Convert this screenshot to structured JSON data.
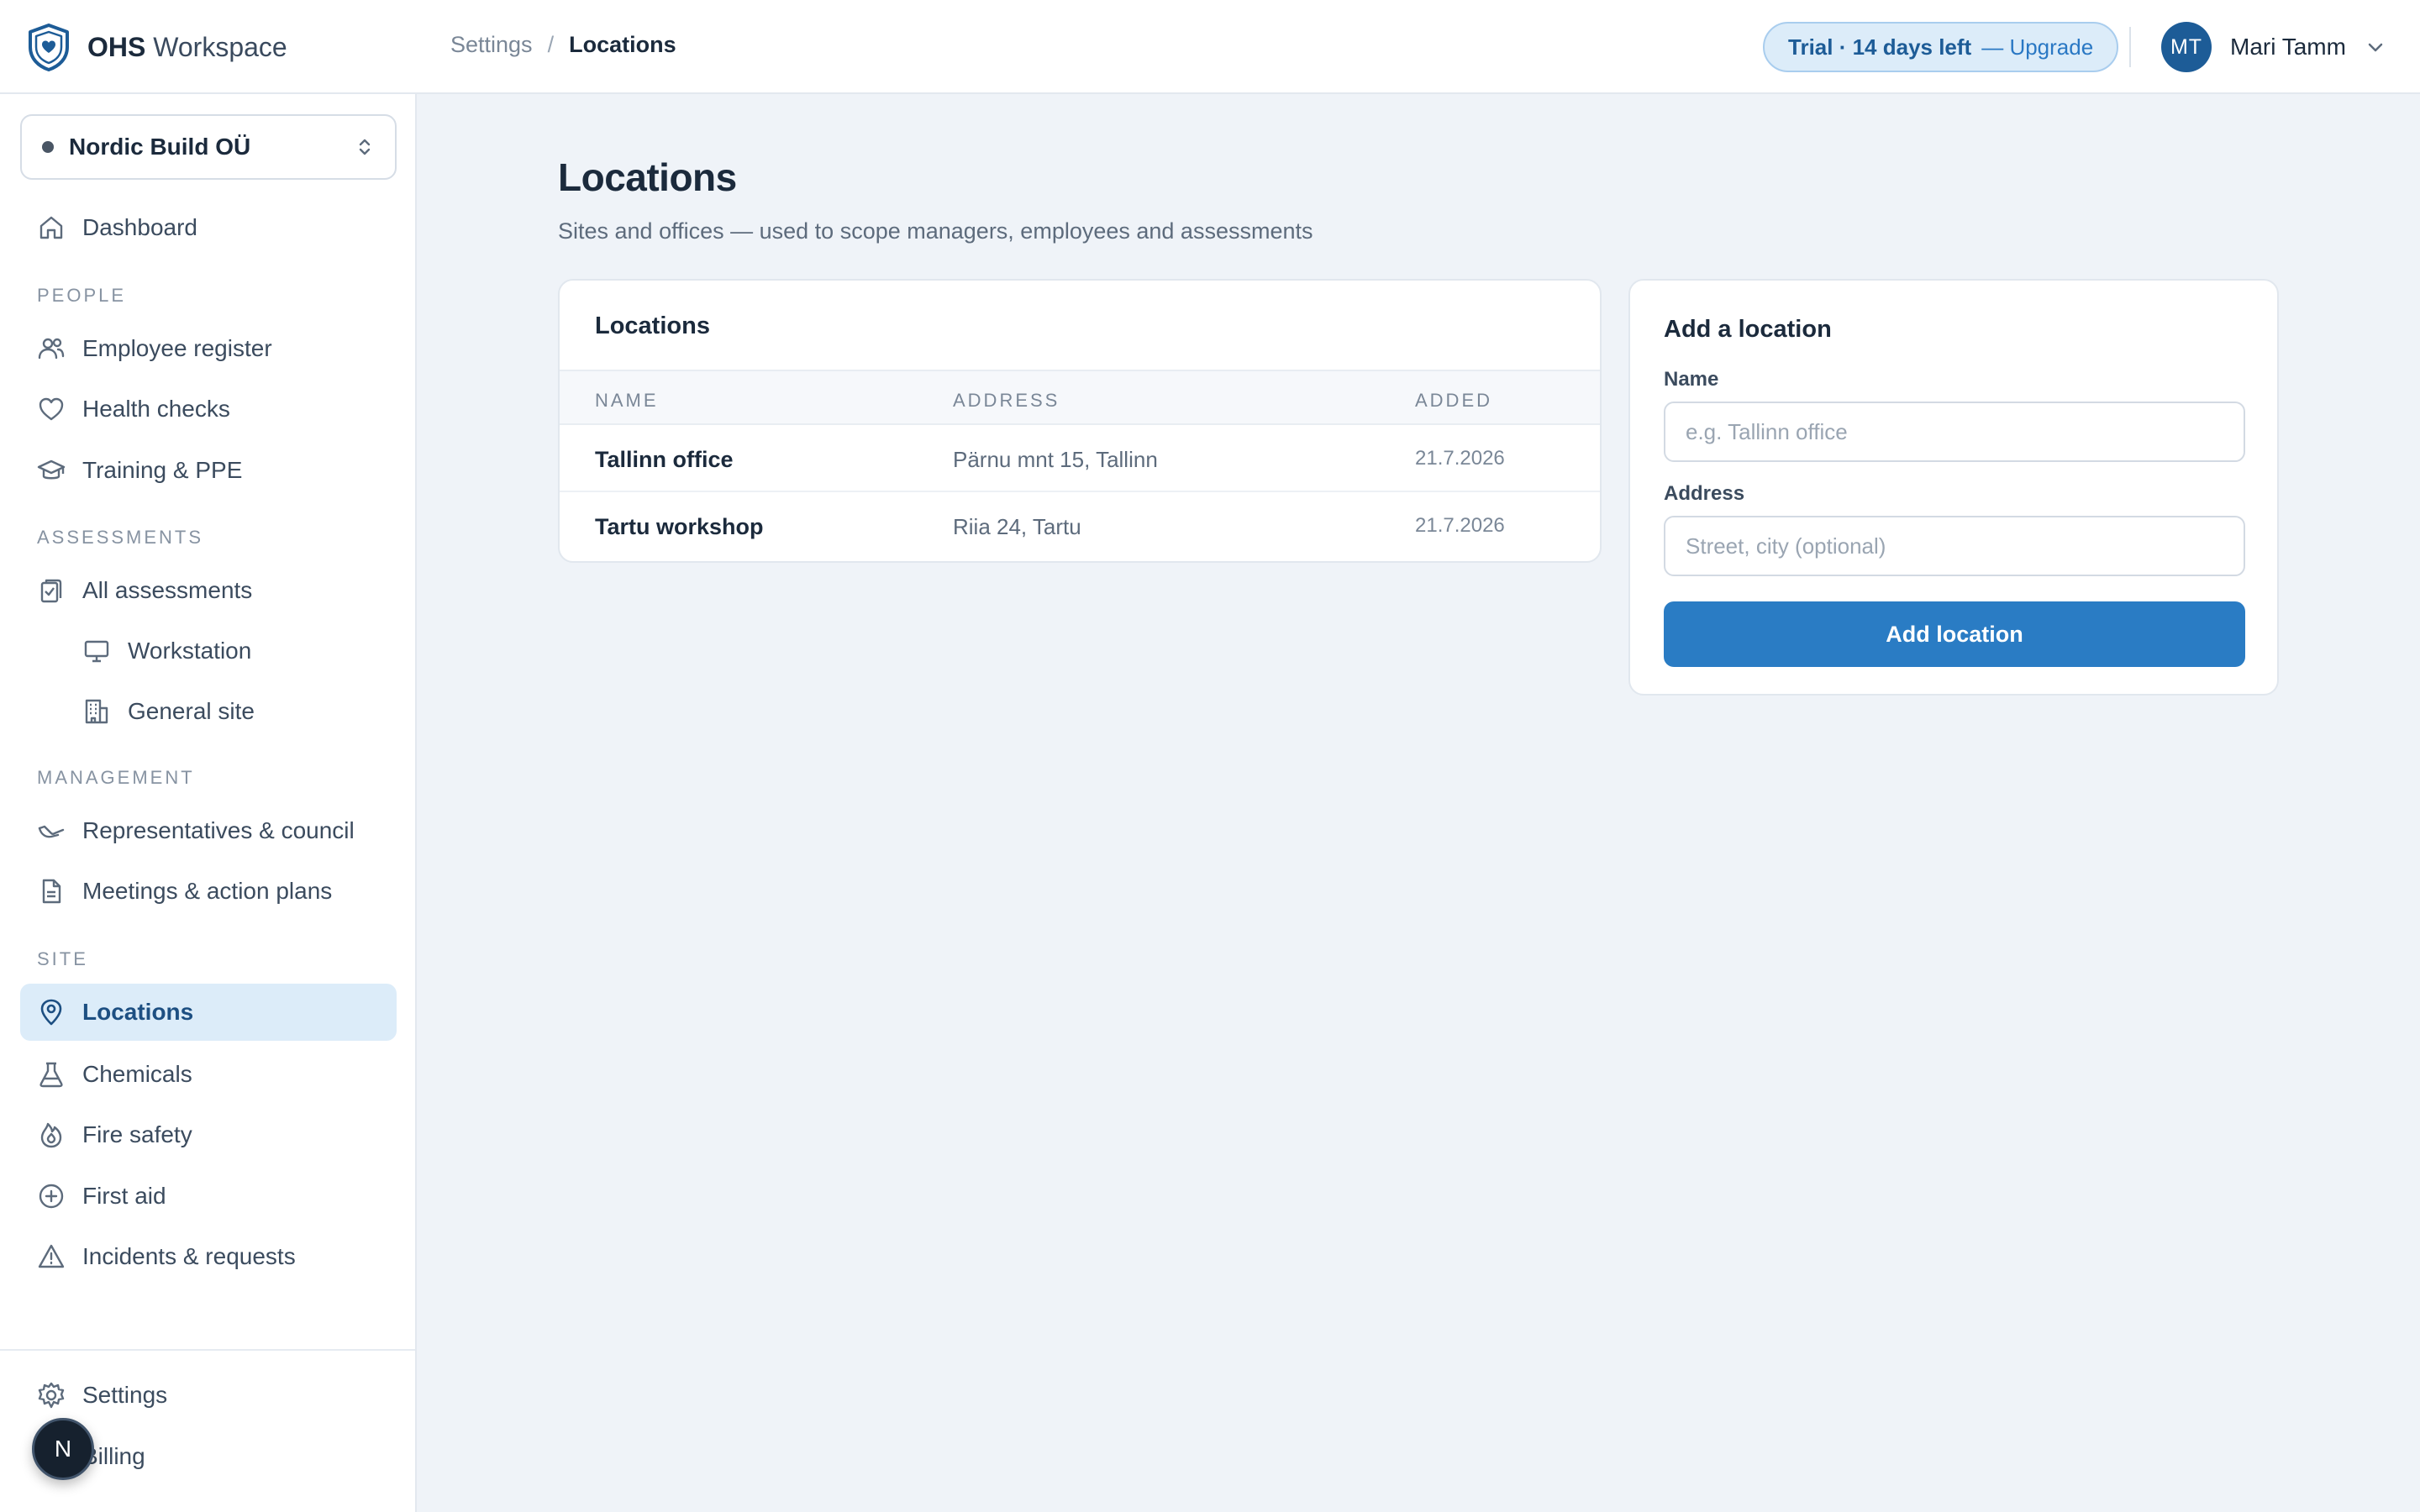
{
  "app": {
    "name_bold": "OHS",
    "name_rest": "Workspace"
  },
  "breadcrumb": {
    "parent": "Settings",
    "separator": "/",
    "current": "Locations"
  },
  "trial": {
    "status": "Trial · 14 days left",
    "action": "— Upgrade"
  },
  "user": {
    "initials": "MT",
    "name": "Mari Tamm"
  },
  "org": {
    "name": "Nordic Build OÜ"
  },
  "sidebar": {
    "dashboard": "Dashboard",
    "sections": {
      "people": "PEOPLE",
      "assessments": "ASSESSMENTS",
      "management": "MANAGEMENT",
      "site": "SITE"
    },
    "items": {
      "employee_register": "Employee register",
      "health_checks": "Health checks",
      "training_ppe": "Training & PPE",
      "all_assessments": "All assessments",
      "workstation": "Workstation",
      "general_site": "General site",
      "representatives": "Representatives & council",
      "meetings": "Meetings & action plans",
      "locations": "Locations",
      "chemicals": "Chemicals",
      "fire_safety": "Fire safety",
      "first_aid": "First aid",
      "incidents": "Incidents & requests",
      "settings": "Settings",
      "billing": "Billing"
    },
    "active": "Locations"
  },
  "fab": {
    "label": "N"
  },
  "page": {
    "title": "Locations",
    "subtitle": "Sites and offices — used to scope managers, employees and assessments"
  },
  "table": {
    "title": "Locations",
    "columns": [
      "NAME",
      "ADDRESS",
      "ADDED"
    ],
    "rows": [
      {
        "name": "Tallinn office",
        "address": "Pärnu mnt 15, Tallinn",
        "added": "21.7.2026"
      },
      {
        "name": "Tartu workshop",
        "address": "Riia 24, Tartu",
        "added": "21.7.2026"
      }
    ]
  },
  "form": {
    "title": "Add a location",
    "name_label": "Name",
    "name_placeholder": "e.g. Tallinn office",
    "name_value": "",
    "address_label": "Address",
    "address_placeholder": "Street, city (optional)",
    "address_value": "",
    "submit": "Add location"
  },
  "colors": {
    "primary": "#2a7cc4",
    "primary_dark": "#1d5c97",
    "active_bg": "#dcecf9",
    "background": "#eff3f8"
  }
}
